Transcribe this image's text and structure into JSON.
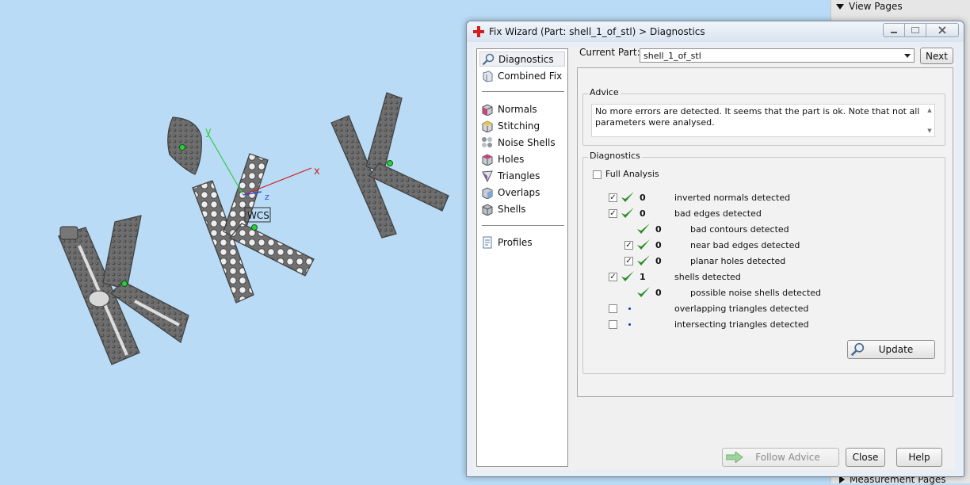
{
  "side_panel": {
    "view_pages_label": "View Pages",
    "measurement_pages_label": "Measurement Pages"
  },
  "viewport": {
    "axis_labels": {
      "x": "x",
      "y": "y",
      "z": "z"
    },
    "wcs_label": "WCS"
  },
  "dialog": {
    "title": "Fix Wizard (Part: shell_1_of_stl) > Diagnostics",
    "nav": {
      "items": [
        {
          "label": "Diagnostics",
          "icon": "magnifier-icon",
          "selected": true
        },
        {
          "label": "Combined Fix",
          "icon": "combined-fix-icon"
        },
        {
          "label": "Normals",
          "icon": "normals-cube-icon"
        },
        {
          "label": "Stitching",
          "icon": "stitching-cube-icon"
        },
        {
          "label": "Noise Shells",
          "icon": "noise-shells-icon"
        },
        {
          "label": "Holes",
          "icon": "holes-cube-icon"
        },
        {
          "label": "Triangles",
          "icon": "triangles-icon"
        },
        {
          "label": "Overlaps",
          "icon": "overlaps-cube-icon"
        },
        {
          "label": "Shells",
          "icon": "shells-cube-icon"
        },
        {
          "label": "Profiles",
          "icon": "profiles-document-icon"
        }
      ]
    },
    "current_part": {
      "label": "Current Part:",
      "value": "shell_1_of_stl",
      "next_label": "Next"
    },
    "advice": {
      "title": "Advice",
      "text": "No more errors are detected. It seems that the part is ok. Note that not all parameters were analysed."
    },
    "diagnostics": {
      "title": "Diagnostics",
      "full_analysis_label": "Full Analysis",
      "full_analysis_checked": false,
      "rows": [
        {
          "checkbox": true,
          "checked": true,
          "status": "ok",
          "count": "0",
          "label": "inverted normals detected",
          "indent": 0
        },
        {
          "checkbox": true,
          "checked": true,
          "status": "ok",
          "count": "0",
          "label": "bad edges detected",
          "indent": 0
        },
        {
          "checkbox": false,
          "checked": false,
          "status": "ok",
          "count": "0",
          "label": "bad contours detected",
          "indent": 1
        },
        {
          "checkbox": true,
          "checked": true,
          "status": "ok",
          "count": "0",
          "label": "near bad edges detected",
          "indent": 1
        },
        {
          "checkbox": true,
          "checked": true,
          "status": "ok",
          "count": "0",
          "label": "planar holes detected",
          "indent": 1
        },
        {
          "checkbox": true,
          "checked": true,
          "status": "ok",
          "count": "1",
          "label": "shells detected",
          "indent": 0
        },
        {
          "checkbox": false,
          "checked": false,
          "status": "ok",
          "count": "0",
          "label": "possible noise shells detected",
          "indent": 1
        },
        {
          "checkbox": true,
          "checked": false,
          "status": "pending",
          "count": "",
          "label": "overlapping triangles detected",
          "indent": 0
        },
        {
          "checkbox": true,
          "checked": false,
          "status": "pending",
          "count": "",
          "label": "intersecting triangles detected",
          "indent": 0
        }
      ],
      "update_label": "Update"
    },
    "buttons": {
      "follow_advice": "Follow Advice",
      "close": "Close",
      "help": "Help"
    }
  }
}
